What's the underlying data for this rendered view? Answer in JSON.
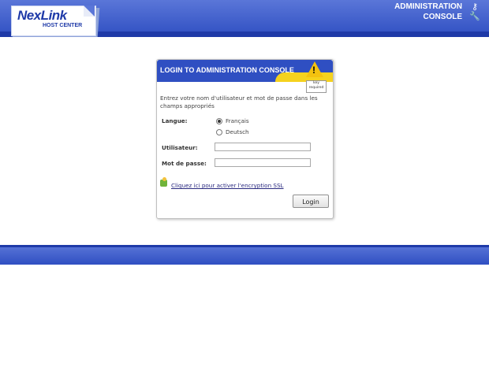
{
  "header": {
    "logo_name": "NexLink",
    "logo_sub": "HOST CENTER",
    "admin_line1": "ADMINISTRATION",
    "admin_line2": "CONSOLE",
    "icons": [
      "key-icon",
      "wrench-icon"
    ]
  },
  "panel": {
    "title": "LOGIN TO ADMINISTRATION CONSOLE",
    "badge_line1": "key",
    "badge_line2": "required",
    "intro": "Entrez votre nom d'utilisateur et mot de passe dans les champs appropriés",
    "language_label": "Langue:",
    "language_options": [
      "Français",
      "Deutsch"
    ],
    "language_selected": "Français",
    "username_label": "Utilisateur:",
    "username_value": "",
    "password_label": "Mot de passe:",
    "password_value": "",
    "ssl_link": "Cliquez ici pour activer l'encryption SSL",
    "login_button": "Login"
  },
  "colors": {
    "brand_blue": "#2f4fc2",
    "accent_yellow": "#f4c20f"
  }
}
